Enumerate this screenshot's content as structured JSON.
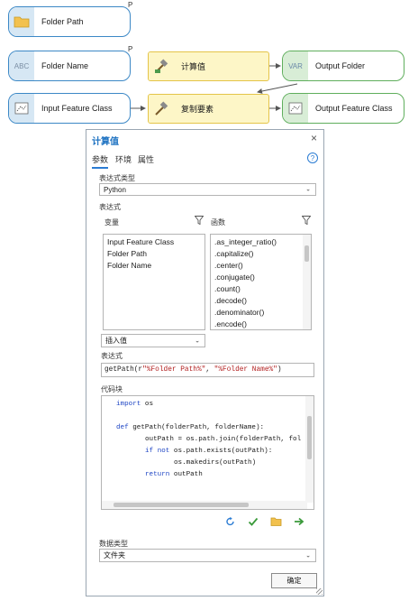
{
  "model": {
    "nodes": {
      "folder_path": {
        "label": "Folder Path",
        "p_mark": "P"
      },
      "folder_name": {
        "label": "Folder Name",
        "p_mark": "P",
        "icon_text": "ABC"
      },
      "calc_value": {
        "label": "计算值"
      },
      "output_folder": {
        "label": "Output Folder",
        "icon_text": "VAR"
      },
      "input_fc": {
        "label": "Input Feature Class"
      },
      "copy_features": {
        "label": "复制要素"
      },
      "output_fc": {
        "label": "Output Feature Class"
      }
    }
  },
  "dialog": {
    "title": "计算值",
    "close_glyph": "×",
    "tabs": [
      "参数",
      "环境",
      "属性"
    ],
    "help_glyph": "?",
    "expr_type_label": "表达式类型",
    "expr_type_value": "Python",
    "expression_section": "表达式",
    "variables_label": "变量",
    "functions_label": "函数",
    "variables": [
      "Input Feature Class",
      "Folder Path",
      "Folder Name"
    ],
    "functions": [
      ".as_integer_ratio()",
      ".capitalize()",
      ".center()",
      ".conjugate()",
      ".count()",
      ".decode()",
      ".denominator()",
      ".encode()"
    ],
    "insert_value_label": "插入值",
    "expression_label": "表达式",
    "expression_prefix": "getPath(r",
    "expression_arg1": "\"%Folder Path%\"",
    "expression_sep": ", ",
    "expression_arg2": "\"%Folder Name%\"",
    "expression_suffix": ")",
    "code_block_label": "代码块",
    "code": {
      "l1_kw": "import",
      "l1_rest": " os",
      "l2_kw": "def",
      "l2_rest": " getPath(folderPath, folderName):",
      "l3": "outPath = os.path.join(folderPath, fol",
      "l4_kw1": "if",
      "l4_kw2": "not",
      "l4_rest": " os.path.exists(outPath):",
      "l5": "os.makedirs(outPath)",
      "l6_kw": "return",
      "l6_rest": " outPath"
    },
    "data_type_label": "数据类型",
    "data_type_value": "文件夹",
    "ok_label": "确定",
    "colors": {
      "accent": "#2b7cd3",
      "title": "#1f73c2",
      "keyword": "#1f46c4",
      "string": "#b11d1d"
    }
  }
}
